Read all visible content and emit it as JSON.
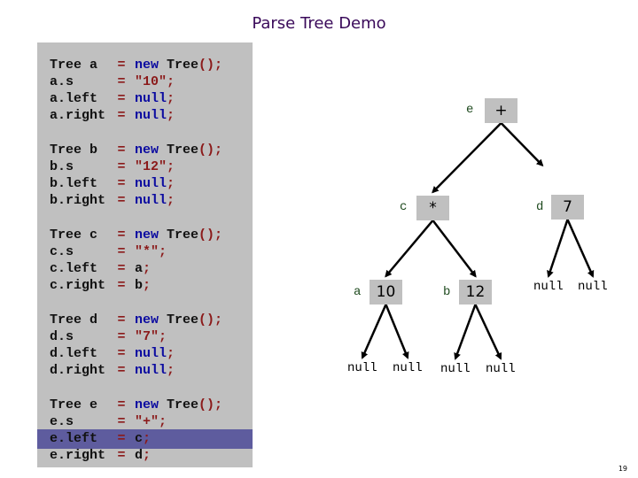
{
  "title": "Parse Tree Demo",
  "page_number": "19",
  "colors": {
    "code_panel_bg": "#c0c0c0",
    "highlight_bg": "#5e5c9e",
    "keyword": "#0a0aa0",
    "string": "#8b1a1a",
    "node_bg": "#c0c0c0",
    "node_label": "#1e4a1e",
    "title": "#3a0a5a"
  },
  "code": {
    "highlighted_line": "e.left",
    "blocks": [
      {
        "lines": [
          {
            "lhs": "Tree a",
            "rhs": [
              {
                "t": "new",
                "c": "kw"
              },
              {
                "t": " Tree",
                "c": "plain"
              },
              {
                "t": "();",
                "c": "punc"
              }
            ]
          },
          {
            "lhs": "a.s",
            "rhs": [
              {
                "t": "\"10\"",
                "c": "str"
              },
              {
                "t": ";",
                "c": "punc"
              }
            ]
          },
          {
            "lhs": "a.left",
            "rhs": [
              {
                "t": "null",
                "c": "kw"
              },
              {
                "t": ";",
                "c": "punc"
              }
            ]
          },
          {
            "lhs": "a.right",
            "rhs": [
              {
                "t": "null",
                "c": "kw"
              },
              {
                "t": ";",
                "c": "punc"
              }
            ]
          }
        ]
      },
      {
        "lines": [
          {
            "lhs": "Tree b",
            "rhs": [
              {
                "t": "new",
                "c": "kw"
              },
              {
                "t": " Tree",
                "c": "plain"
              },
              {
                "t": "();",
                "c": "punc"
              }
            ]
          },
          {
            "lhs": "b.s",
            "rhs": [
              {
                "t": "\"12\"",
                "c": "str"
              },
              {
                "t": ";",
                "c": "punc"
              }
            ]
          },
          {
            "lhs": "b.left",
            "rhs": [
              {
                "t": "null",
                "c": "kw"
              },
              {
                "t": ";",
                "c": "punc"
              }
            ]
          },
          {
            "lhs": "b.right",
            "rhs": [
              {
                "t": "null",
                "c": "kw"
              },
              {
                "t": ";",
                "c": "punc"
              }
            ]
          }
        ]
      },
      {
        "lines": [
          {
            "lhs": "Tree c",
            "rhs": [
              {
                "t": "new",
                "c": "kw"
              },
              {
                "t": " Tree",
                "c": "plain"
              },
              {
                "t": "();",
                "c": "punc"
              }
            ]
          },
          {
            "lhs": "c.s",
            "rhs": [
              {
                "t": "\"*\"",
                "c": "str"
              },
              {
                "t": ";",
                "c": "punc"
              }
            ]
          },
          {
            "lhs": "c.left",
            "rhs": [
              {
                "t": "a",
                "c": "plain"
              },
              {
                "t": ";",
                "c": "punc"
              }
            ]
          },
          {
            "lhs": "c.right",
            "rhs": [
              {
                "t": "b",
                "c": "plain"
              },
              {
                "t": ";",
                "c": "punc"
              }
            ]
          }
        ]
      },
      {
        "lines": [
          {
            "lhs": "Tree d",
            "rhs": [
              {
                "t": "new",
                "c": "kw"
              },
              {
                "t": " Tree",
                "c": "plain"
              },
              {
                "t": "();",
                "c": "punc"
              }
            ]
          },
          {
            "lhs": "d.s",
            "rhs": [
              {
                "t": "\"7\"",
                "c": "str"
              },
              {
                "t": ";",
                "c": "punc"
              }
            ]
          },
          {
            "lhs": "d.left",
            "rhs": [
              {
                "t": "null",
                "c": "kw"
              },
              {
                "t": ";",
                "c": "punc"
              }
            ]
          },
          {
            "lhs": "d.right",
            "rhs": [
              {
                "t": "null",
                "c": "kw"
              },
              {
                "t": ";",
                "c": "punc"
              }
            ]
          }
        ]
      },
      {
        "lines": [
          {
            "lhs": "Tree e",
            "rhs": [
              {
                "t": "new",
                "c": "kw"
              },
              {
                "t": " Tree",
                "c": "plain"
              },
              {
                "t": "();",
                "c": "punc"
              }
            ]
          },
          {
            "lhs": "e.s",
            "rhs": [
              {
                "t": "\"+\"",
                "c": "str"
              },
              {
                "t": ";",
                "c": "punc"
              }
            ]
          },
          {
            "lhs": "e.left",
            "rhs": [
              {
                "t": "c",
                "c": "plain"
              },
              {
                "t": ";",
                "c": "punc"
              }
            ]
          },
          {
            "lhs": "e.right",
            "rhs": [
              {
                "t": "d",
                "c": "plain"
              },
              {
                "t": ";",
                "c": "punc"
              }
            ]
          }
        ]
      }
    ]
  },
  "tree": {
    "nodes": [
      {
        "id": "e",
        "label": "e",
        "value": "+"
      },
      {
        "id": "c",
        "label": "c",
        "value": "*"
      },
      {
        "id": "d",
        "label": "d",
        "value": "7"
      },
      {
        "id": "a",
        "label": "a",
        "value": "10"
      },
      {
        "id": "b",
        "label": "b",
        "value": "12"
      }
    ],
    "edges": [
      {
        "from": "e",
        "to": "c"
      },
      {
        "from": "e",
        "to": "d",
        "partial": true
      },
      {
        "from": "c",
        "to": "a"
      },
      {
        "from": "c",
        "to": "b"
      },
      {
        "from": "d",
        "to": "null-d-left"
      },
      {
        "from": "d",
        "to": "null-d-right"
      },
      {
        "from": "a",
        "to": "null-a-left"
      },
      {
        "from": "a",
        "to": "null-a-right"
      },
      {
        "from": "b",
        "to": "null-b-left"
      },
      {
        "from": "b",
        "to": "null-b-right"
      }
    ],
    "null_text": "null",
    "nulls": [
      "null-a-left",
      "null-a-right",
      "null-b-left",
      "null-b-right",
      "null-d-left",
      "null-d-right"
    ]
  }
}
